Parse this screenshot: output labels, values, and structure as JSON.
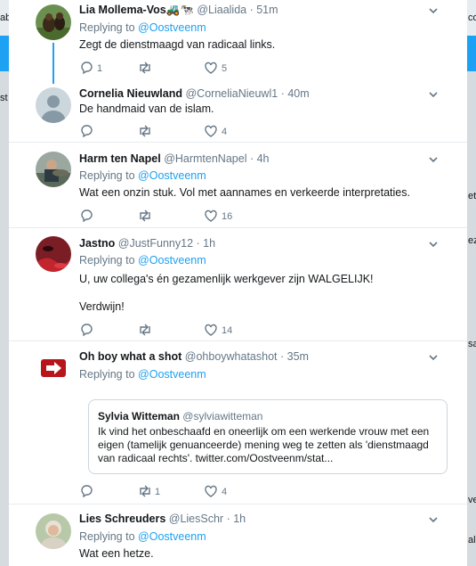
{
  "background": {
    "side_fragments": [
      "ab",
      "co",
      "st",
      "et",
      "ez",
      "sa",
      "ve",
      "al"
    ]
  },
  "tweets": [
    {
      "name": "Lia Mollema-Vos🚜🐄",
      "handle": "@Liaalida",
      "time": "51m",
      "reply_prefix": "Replying to",
      "reply_to": "@Oostveenm",
      "text": "Zegt de dienstmaagd van radicaal links.",
      "replies": "1",
      "retweets": "",
      "likes": "5"
    },
    {
      "name": "Cornelia Nieuwland",
      "handle": "@CorneliaNieuwl1",
      "time": "40m",
      "text": "De handmaid van de islam.",
      "replies": "",
      "retweets": "",
      "likes": "4"
    },
    {
      "name": "Harm ten Napel",
      "handle": "@HarmtenNapel",
      "time": "4h",
      "reply_prefix": "Replying to",
      "reply_to": "@Oostveenm",
      "text": "Wat een onzin stuk. Vol met aannames en verkeerde interpretaties.",
      "replies": "",
      "retweets": "",
      "likes": "16"
    },
    {
      "name": "Jastno",
      "handle": "@JustFunny12",
      "time": "1h",
      "reply_prefix": "Replying to",
      "reply_to": "@Oostveenm",
      "text": "U, uw collega's én gezamenlijk werkgever zijn WALGELIJK!",
      "text2": "Verdwijn!",
      "replies": "",
      "retweets": "",
      "likes": "14"
    },
    {
      "name": "Oh boy what a shot",
      "handle": "@ohboywhatashot",
      "time": "35m",
      "reply_prefix": "Replying to",
      "reply_to": "@Oostveenm",
      "quote": {
        "name": "Sylvia Witteman",
        "handle": "@sylviawitteman",
        "text": "Ik vind het onbeschaafd en oneerlijk om een werkende vrouw met een eigen (tamelijk genuanceerde) mening weg te zetten als 'dienstmaagd van radicaal rechts'. twitter.com/Oostveenm/stat..."
      },
      "replies": "",
      "retweets": "1",
      "likes": "4"
    },
    {
      "name": "Lies Schreuders",
      "handle": "@LiesSchr",
      "time": "1h",
      "reply_prefix": "Replying to",
      "reply_to": "@Oostveenm",
      "text": "Wat een hetze."
    }
  ],
  "colors": {
    "accent": "#1da1f2",
    "text": "#14171a",
    "muted": "#657786",
    "border": "#e6ecf0"
  }
}
